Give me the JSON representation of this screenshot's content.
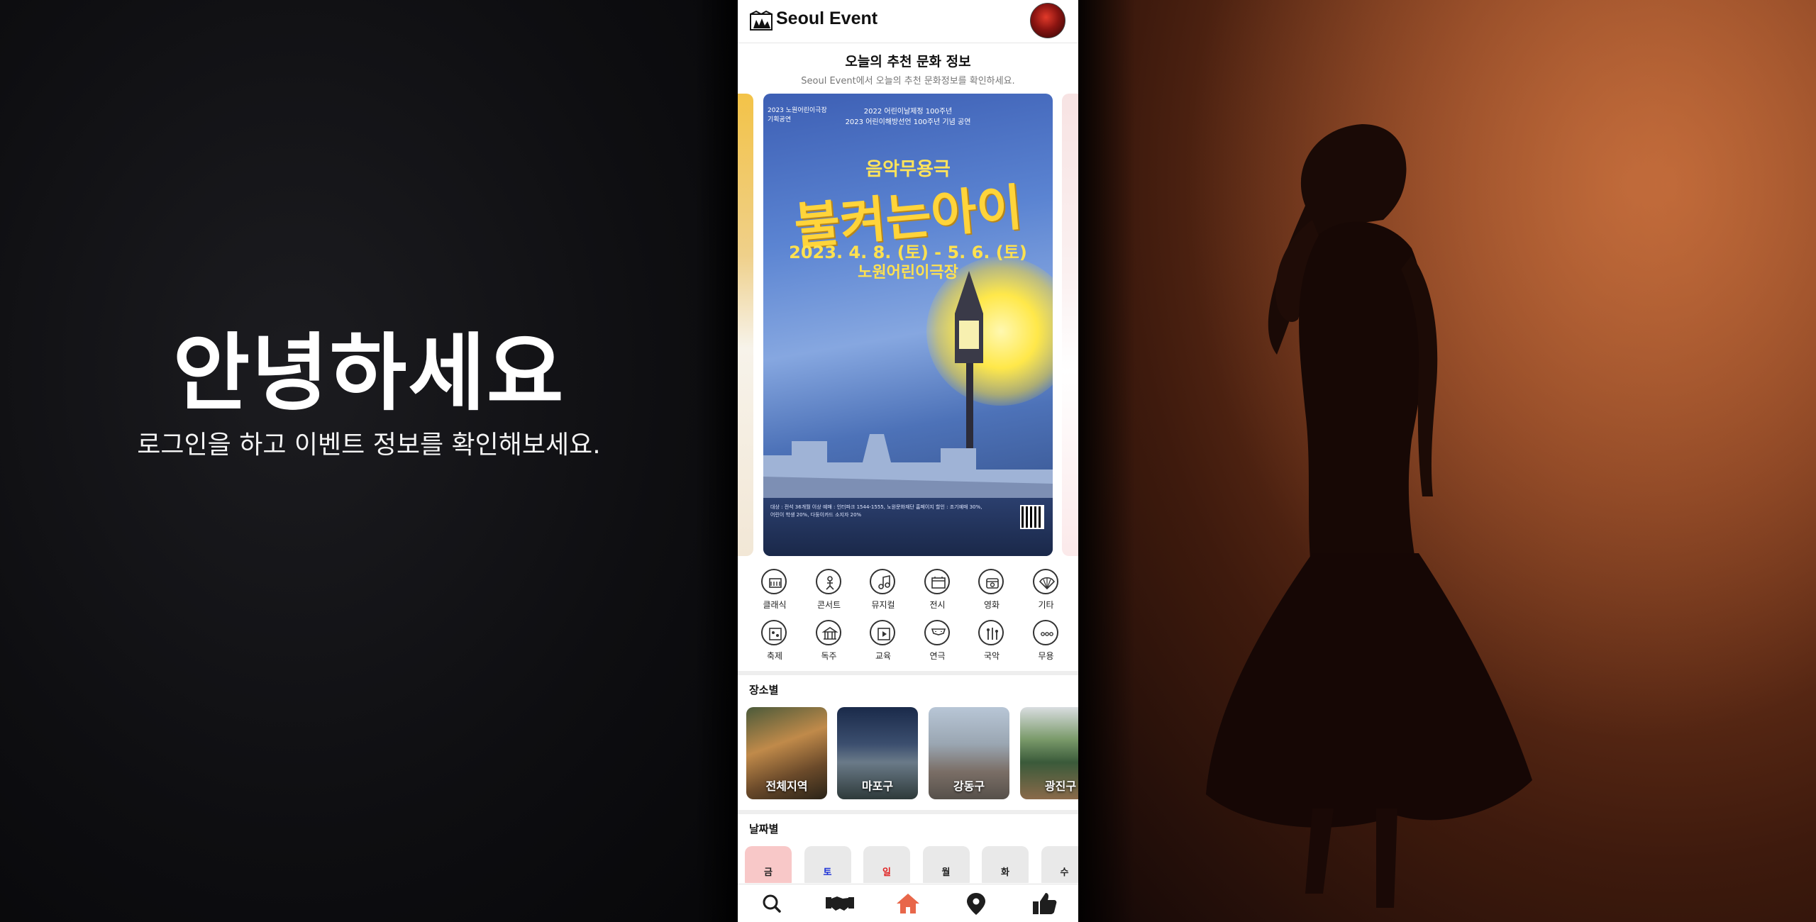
{
  "left": {
    "greeting": "안녕하세요",
    "subtitle": "로그인을 하고 이벤트 정보를 확인해보세요."
  },
  "app": {
    "title": "Seoul Event",
    "recommend_title": "오늘의 추천 문화 정보",
    "recommend_subtitle": "Seoul Event에서 오늘의 추천 문화정보를 확인하세요."
  },
  "poster": {
    "top_line1": "2022 어린이날제정 100주년",
    "top_line2": "2023 어린이해방선언 100주년 기념 공연",
    "corner_line1": "2023 노원어린이극장",
    "corner_line2": "기획공연",
    "genre": "음악무용극",
    "title": "불켜는아이",
    "dates": "2023. 4. 8. (토) - 5. 6. (토)",
    "venue": "노원어린이극장",
    "info": "대상 : 전석 36개월 이상   예매 : 인터파크 1544-1555, 노원문화재단 홈페이지   할인 : 조기예매 30%, 어린이 학생 20%, 다둥이카드 소지자 20%"
  },
  "categories": [
    {
      "label": "클래식",
      "icon": "classic-icon"
    },
    {
      "label": "콘서트",
      "icon": "concert-icon"
    },
    {
      "label": "뮤지컬",
      "icon": "musical-icon"
    },
    {
      "label": "전시",
      "icon": "exhibition-icon"
    },
    {
      "label": "영화",
      "icon": "movie-icon"
    },
    {
      "label": "기타",
      "icon": "fan-icon"
    },
    {
      "label": "축제",
      "icon": "festival-icon"
    },
    {
      "label": "독주",
      "icon": "solo-icon"
    },
    {
      "label": "교육",
      "icon": "education-icon"
    },
    {
      "label": "연극",
      "icon": "theater-icon"
    },
    {
      "label": "국악",
      "icon": "gugak-icon"
    },
    {
      "label": "무용",
      "icon": "more-icon"
    }
  ],
  "places_section": {
    "title": "장소별",
    "items": [
      "전체지역",
      "마포구",
      "강동구",
      "광진구"
    ]
  },
  "dates_section": {
    "title": "날짜별",
    "items": [
      {
        "label": "금",
        "color": "#222222",
        "bg": "#f8c8c8"
      },
      {
        "label": "토",
        "color": "#1a2fd6",
        "bg": "#e9e9e9"
      },
      {
        "label": "일",
        "color": "#e02020",
        "bg": "#e9e9e9"
      },
      {
        "label": "월",
        "color": "#222222",
        "bg": "#e9e9e9"
      },
      {
        "label": "화",
        "color": "#222222",
        "bg": "#e9e9e9"
      },
      {
        "label": "수",
        "color": "#222222",
        "bg": "#e9e9e9"
      }
    ]
  },
  "nav": [
    {
      "icon": "search-icon",
      "active": false
    },
    {
      "icon": "handshake-icon",
      "active": false
    },
    {
      "icon": "home-icon",
      "active": true
    },
    {
      "icon": "location-pin-icon",
      "active": false
    },
    {
      "icon": "thumbs-up-icon",
      "active": false
    }
  ],
  "colors": {
    "accent": "#e8674a",
    "nav_icon": "#1e1e1e"
  }
}
